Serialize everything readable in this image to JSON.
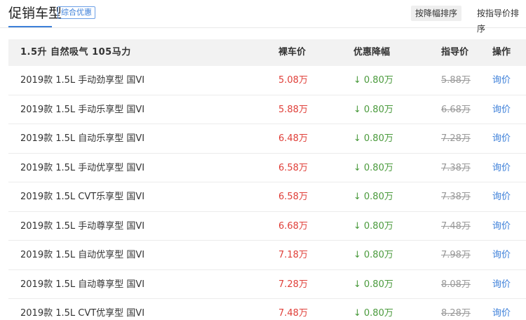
{
  "header": {
    "title": "促销车型",
    "badge": "综合优惠",
    "sort_buttons": [
      "按降幅排序",
      "按指导价排序"
    ]
  },
  "table": {
    "group_title": "1.5升 自然吸气 105马力",
    "columns": [
      "裸车价",
      "优惠降幅",
      "指导价",
      "操作"
    ],
    "rows": [
      {
        "name": "2019款 1.5L 手动劲享型 国VI",
        "price": "5.08万",
        "discount": "0.80万",
        "guide": "5.88万",
        "action": "询价"
      },
      {
        "name": "2019款 1.5L 手动乐享型 国VI",
        "price": "5.88万",
        "discount": "0.80万",
        "guide": "6.68万",
        "action": "询价"
      },
      {
        "name": "2019款 1.5L 自动乐享型 国VI",
        "price": "6.48万",
        "discount": "0.80万",
        "guide": "7.28万",
        "action": "询价"
      },
      {
        "name": "2019款 1.5L 手动优享型 国VI",
        "price": "6.58万",
        "discount": "0.80万",
        "guide": "7.38万",
        "action": "询价"
      },
      {
        "name": "2019款 1.5L CVT乐享型 国VI",
        "price": "6.58万",
        "discount": "0.80万",
        "guide": "7.38万",
        "action": "询价"
      },
      {
        "name": "2019款 1.5L 手动尊享型 国VI",
        "price": "6.68万",
        "discount": "0.80万",
        "guide": "7.48万",
        "action": "询价"
      },
      {
        "name": "2019款 1.5L 自动优享型 国VI",
        "price": "7.18万",
        "discount": "0.80万",
        "guide": "7.98万",
        "action": "询价"
      },
      {
        "name": "2019款 1.5L 自动尊享型 国VI",
        "price": "7.28万",
        "discount": "0.80万",
        "guide": "8.08万",
        "action": "询价"
      },
      {
        "name": "2019款 1.5L CVT优享型 国VI",
        "price": "7.48万",
        "discount": "0.80万",
        "guide": "8.28万",
        "action": "询价"
      }
    ]
  },
  "icons": {
    "discount_arrow": "down-arrow-icon"
  },
  "colors": {
    "accent": "#3c7fd9",
    "price": "#e0403a",
    "discount": "#4a9a3c",
    "strike": "#999999"
  }
}
